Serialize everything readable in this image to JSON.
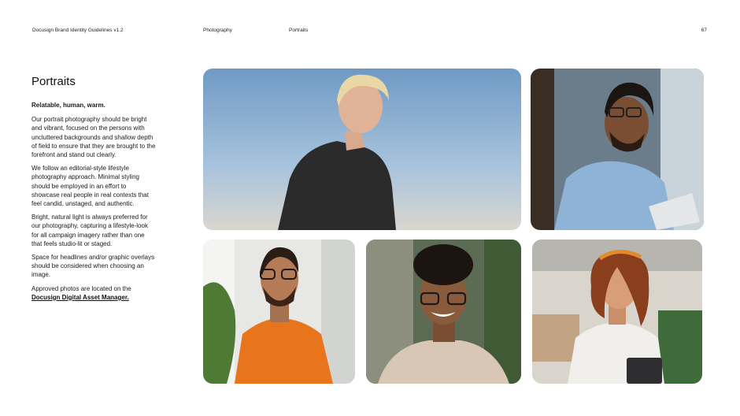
{
  "header": {
    "doc_title": "Docusign Brand Identity Guidelines v1.2",
    "section": "Photography",
    "subsection": "Portraits",
    "page_number": "67"
  },
  "content": {
    "title": "Portraits",
    "lead": "Relatable, human, warm.",
    "paragraphs": [
      "Our portrait photography should be bright and vibrant, focused on the persons with uncluttered backgrounds and shallow depth of field to ensure that they are brought to the forefront and stand out clearly.",
      "We follow an editorial-style lifestyle photography approach. Minimal styling should be employed in an effort to showcase real people in real contexts that feel candid, unstaged, and authentic.",
      "Bright, natural light is always preferred for our photography, capturing a lifestyle-look for all campaign imagery rather than one that feels studio-lit or staged.",
      "Space for headlines and/or graphic overlays should be considered when choosing an image."
    ],
    "approved_prefix": "Approved photos are located on the",
    "approved_link": "Docusign Digital Asset Manager."
  }
}
